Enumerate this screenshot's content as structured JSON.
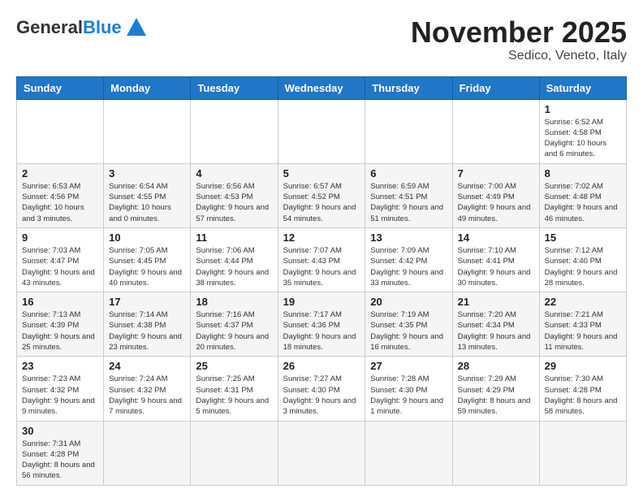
{
  "header": {
    "logo_general": "General",
    "logo_blue": "Blue",
    "month_title": "November 2025",
    "location": "Sedico, Veneto, Italy"
  },
  "weekdays": [
    "Sunday",
    "Monday",
    "Tuesday",
    "Wednesday",
    "Thursday",
    "Friday",
    "Saturday"
  ],
  "weeks": [
    [
      {
        "day": "",
        "content": ""
      },
      {
        "day": "",
        "content": ""
      },
      {
        "day": "",
        "content": ""
      },
      {
        "day": "",
        "content": ""
      },
      {
        "day": "",
        "content": ""
      },
      {
        "day": "",
        "content": ""
      },
      {
        "day": "1",
        "content": "Sunrise: 6:52 AM\nSunset: 4:58 PM\nDaylight: 10 hours and 6 minutes."
      }
    ],
    [
      {
        "day": "2",
        "content": "Sunrise: 6:53 AM\nSunset: 4:56 PM\nDaylight: 10 hours and 3 minutes."
      },
      {
        "day": "3",
        "content": "Sunrise: 6:54 AM\nSunset: 4:55 PM\nDaylight: 10 hours and 0 minutes."
      },
      {
        "day": "4",
        "content": "Sunrise: 6:56 AM\nSunset: 4:53 PM\nDaylight: 9 hours and 57 minutes."
      },
      {
        "day": "5",
        "content": "Sunrise: 6:57 AM\nSunset: 4:52 PM\nDaylight: 9 hours and 54 minutes."
      },
      {
        "day": "6",
        "content": "Sunrise: 6:59 AM\nSunset: 4:51 PM\nDaylight: 9 hours and 51 minutes."
      },
      {
        "day": "7",
        "content": "Sunrise: 7:00 AM\nSunset: 4:49 PM\nDaylight: 9 hours and 49 minutes."
      },
      {
        "day": "8",
        "content": "Sunrise: 7:02 AM\nSunset: 4:48 PM\nDaylight: 9 hours and 46 minutes."
      }
    ],
    [
      {
        "day": "9",
        "content": "Sunrise: 7:03 AM\nSunset: 4:47 PM\nDaylight: 9 hours and 43 minutes."
      },
      {
        "day": "10",
        "content": "Sunrise: 7:05 AM\nSunset: 4:45 PM\nDaylight: 9 hours and 40 minutes."
      },
      {
        "day": "11",
        "content": "Sunrise: 7:06 AM\nSunset: 4:44 PM\nDaylight: 9 hours and 38 minutes."
      },
      {
        "day": "12",
        "content": "Sunrise: 7:07 AM\nSunset: 4:43 PM\nDaylight: 9 hours and 35 minutes."
      },
      {
        "day": "13",
        "content": "Sunrise: 7:09 AM\nSunset: 4:42 PM\nDaylight: 9 hours and 33 minutes."
      },
      {
        "day": "14",
        "content": "Sunrise: 7:10 AM\nSunset: 4:41 PM\nDaylight: 9 hours and 30 minutes."
      },
      {
        "day": "15",
        "content": "Sunrise: 7:12 AM\nSunset: 4:40 PM\nDaylight: 9 hours and 28 minutes."
      }
    ],
    [
      {
        "day": "16",
        "content": "Sunrise: 7:13 AM\nSunset: 4:39 PM\nDaylight: 9 hours and 25 minutes."
      },
      {
        "day": "17",
        "content": "Sunrise: 7:14 AM\nSunset: 4:38 PM\nDaylight: 9 hours and 23 minutes."
      },
      {
        "day": "18",
        "content": "Sunrise: 7:16 AM\nSunset: 4:37 PM\nDaylight: 9 hours and 20 minutes."
      },
      {
        "day": "19",
        "content": "Sunrise: 7:17 AM\nSunset: 4:36 PM\nDaylight: 9 hours and 18 minutes."
      },
      {
        "day": "20",
        "content": "Sunrise: 7:19 AM\nSunset: 4:35 PM\nDaylight: 9 hours and 16 minutes."
      },
      {
        "day": "21",
        "content": "Sunrise: 7:20 AM\nSunset: 4:34 PM\nDaylight: 9 hours and 13 minutes."
      },
      {
        "day": "22",
        "content": "Sunrise: 7:21 AM\nSunset: 4:33 PM\nDaylight: 9 hours and 11 minutes."
      }
    ],
    [
      {
        "day": "23",
        "content": "Sunrise: 7:23 AM\nSunset: 4:32 PM\nDaylight: 9 hours and 9 minutes."
      },
      {
        "day": "24",
        "content": "Sunrise: 7:24 AM\nSunset: 4:32 PM\nDaylight: 9 hours and 7 minutes."
      },
      {
        "day": "25",
        "content": "Sunrise: 7:25 AM\nSunset: 4:31 PM\nDaylight: 9 hours and 5 minutes."
      },
      {
        "day": "26",
        "content": "Sunrise: 7:27 AM\nSunset: 4:30 PM\nDaylight: 9 hours and 3 minutes."
      },
      {
        "day": "27",
        "content": "Sunrise: 7:28 AM\nSunset: 4:30 PM\nDaylight: 9 hours and 1 minute."
      },
      {
        "day": "28",
        "content": "Sunrise: 7:29 AM\nSunset: 4:29 PM\nDaylight: 8 hours and 59 minutes."
      },
      {
        "day": "29",
        "content": "Sunrise: 7:30 AM\nSunset: 4:28 PM\nDaylight: 8 hours and 58 minutes."
      }
    ],
    [
      {
        "day": "30",
        "content": "Sunrise: 7:31 AM\nSunset: 4:28 PM\nDaylight: 8 hours and 56 minutes."
      },
      {
        "day": "",
        "content": ""
      },
      {
        "day": "",
        "content": ""
      },
      {
        "day": "",
        "content": ""
      },
      {
        "day": "",
        "content": ""
      },
      {
        "day": "",
        "content": ""
      },
      {
        "day": "",
        "content": ""
      }
    ]
  ]
}
